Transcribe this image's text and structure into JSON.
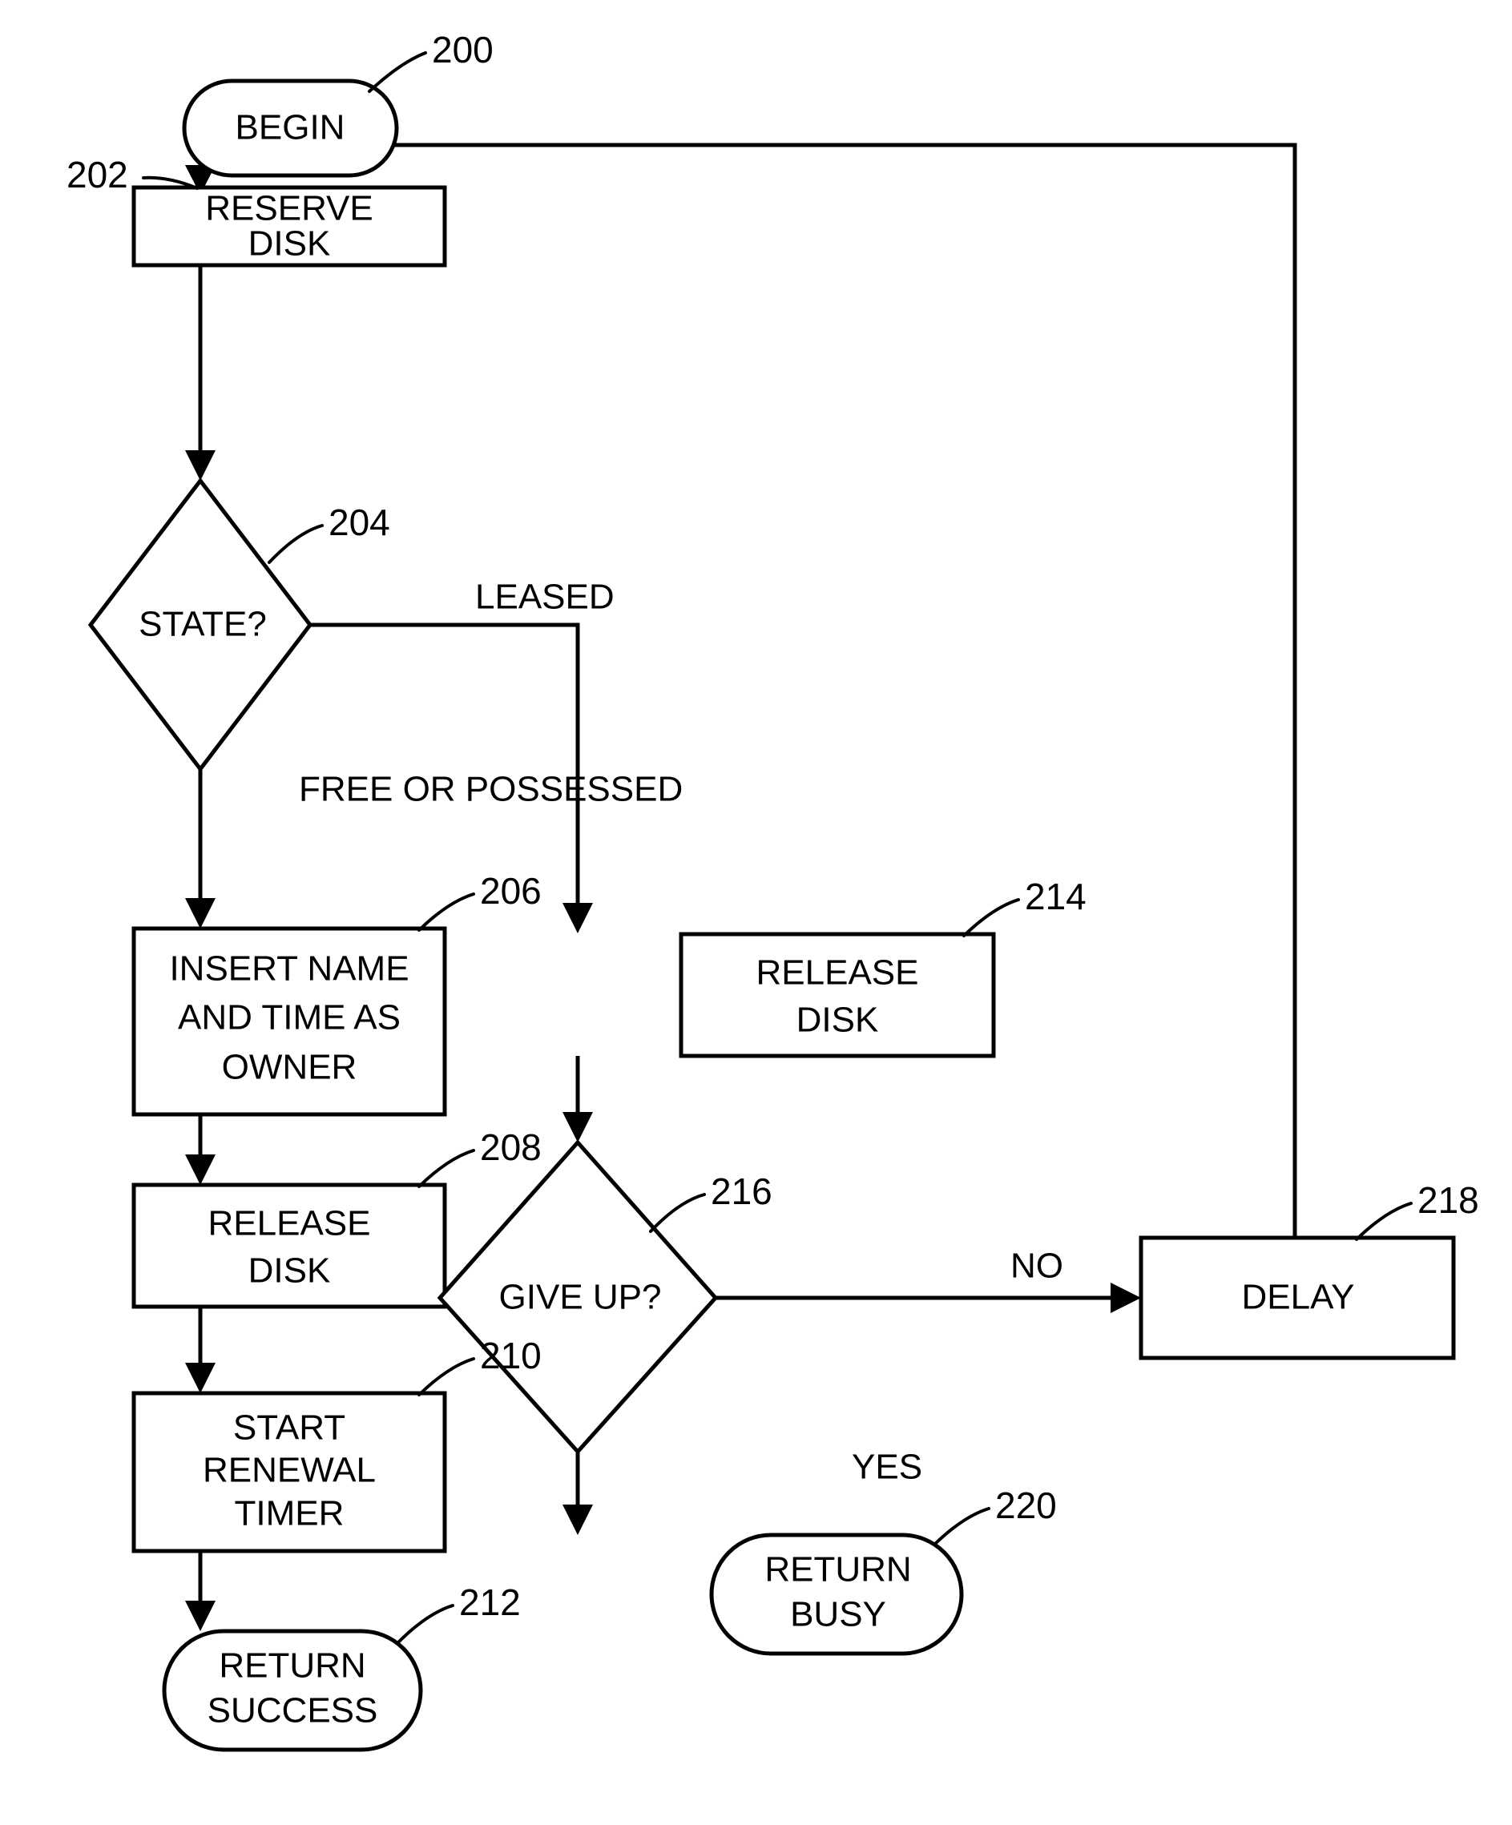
{
  "diagram": {
    "type": "flowchart",
    "title": "Disk lease acquisition flowchart",
    "nodes": [
      {
        "id": "begin",
        "ref": "200",
        "shape": "terminator",
        "lines": [
          "BEGIN"
        ],
        "line1": "BEGIN"
      },
      {
        "id": "reserve_disk",
        "ref": "202",
        "shape": "process",
        "lines": [
          "RESERVE",
          "DISK"
        ],
        "line1": "RESERVE",
        "line2": "DISK"
      },
      {
        "id": "state_decision",
        "ref": "204",
        "shape": "decision",
        "lines": [
          "STATE?"
        ],
        "line1": "STATE?"
      },
      {
        "id": "insert_name",
        "ref": "206",
        "shape": "process",
        "lines": [
          "INSERT NAME",
          "AND TIME AS",
          "OWNER"
        ],
        "line1": "INSERT NAME",
        "line2": "AND TIME AS",
        "line3": "OWNER"
      },
      {
        "id": "release_disk_left",
        "ref": "208",
        "shape": "process",
        "lines": [
          "RELEASE",
          "DISK"
        ],
        "line1": "RELEASE",
        "line2": "DISK"
      },
      {
        "id": "start_renewal_timer",
        "ref": "210",
        "shape": "process",
        "lines": [
          "START",
          "RENEWAL",
          "TIMER"
        ],
        "line1": "START",
        "line2": "RENEWAL",
        "line3": "TIMER"
      },
      {
        "id": "return_success",
        "ref": "212",
        "shape": "terminator",
        "lines": [
          "RETURN",
          "SUCCESS"
        ],
        "line1": "RETURN",
        "line2": "SUCCESS"
      },
      {
        "id": "release_disk_right",
        "ref": "214",
        "shape": "process",
        "lines": [
          "RELEASE",
          "DISK"
        ],
        "line1": "RELEASE",
        "line2": "DISK"
      },
      {
        "id": "give_up_decision",
        "ref": "216",
        "shape": "decision",
        "lines": [
          "GIVE UP?"
        ],
        "line1": "GIVE UP?"
      },
      {
        "id": "delay",
        "ref": "218",
        "shape": "process",
        "lines": [
          "DELAY"
        ],
        "line1": "DELAY"
      },
      {
        "id": "return_busy",
        "ref": "220",
        "shape": "terminator",
        "lines": [
          "RETURN",
          "BUSY"
        ],
        "line1": "RETURN",
        "line2": "BUSY"
      }
    ],
    "edge_labels": {
      "leased": "LEASED",
      "free_or_possessed": "FREE OR POSSESSED",
      "no": "NO",
      "yes": "YES"
    },
    "reference_numerals": {
      "begin": "200",
      "reserve_disk": "202",
      "state_decision": "204",
      "insert_name": "206",
      "release_disk_left": "208",
      "start_renewal_timer": "210",
      "return_success": "212",
      "release_disk_right": "214",
      "give_up_decision": "216",
      "delay": "218",
      "return_busy": "220"
    },
    "colors": {
      "stroke": "#000000",
      "fill": "#ffffff",
      "background": "#ffffff"
    }
  }
}
